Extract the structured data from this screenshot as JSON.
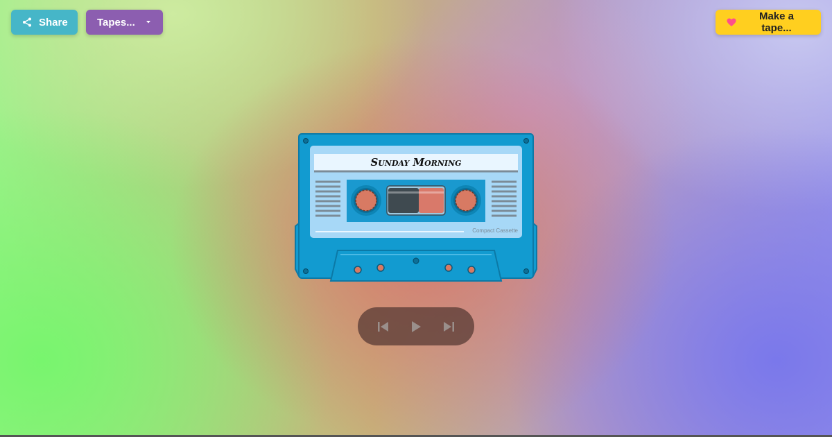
{
  "toolbar": {
    "share_label": "Share",
    "tapes_label": "Tapes...",
    "make_label": "Make a tape..."
  },
  "cassette": {
    "title": "Sunday Morning",
    "brand": "Compact Cassette"
  },
  "colors": {
    "share": "#46b6c8",
    "tapes": "#8c5eb0",
    "make": "#ffcf1f",
    "heart": "#ff4f8b",
    "cassette_body": "#129bd0",
    "cassette_label": "#a7d8f7",
    "player_bg": "#5c3e37"
  },
  "icons": {
    "share": "share-icon",
    "tapes_caret": "chevron-down-icon",
    "make": "heart-icon",
    "prev": "skip-previous-icon",
    "play": "play-icon",
    "next": "skip-next-icon"
  }
}
